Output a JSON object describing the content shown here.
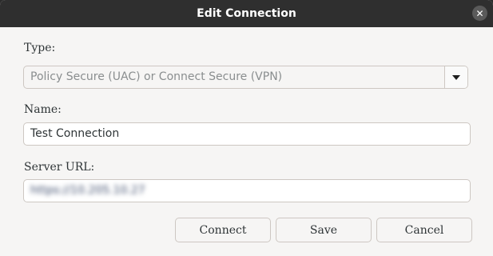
{
  "window": {
    "title": "Edit Connection",
    "close_icon_glyph": "✕"
  },
  "form": {
    "type_label": "Type:",
    "type_value": "Policy Secure (UAC) or Connect Secure (VPN)",
    "name_label": "Name:",
    "name_value": "Test Connection",
    "server_label": "Server URL:",
    "server_value": "https://10.205.10.27"
  },
  "buttons": {
    "connect": "Connect",
    "save": "Save",
    "cancel": "Cancel"
  },
  "colors": {
    "titlebar": "#2f2f2f",
    "background": "#f6f5f4",
    "border": "#cdc7c2",
    "text": "#2e3436"
  }
}
